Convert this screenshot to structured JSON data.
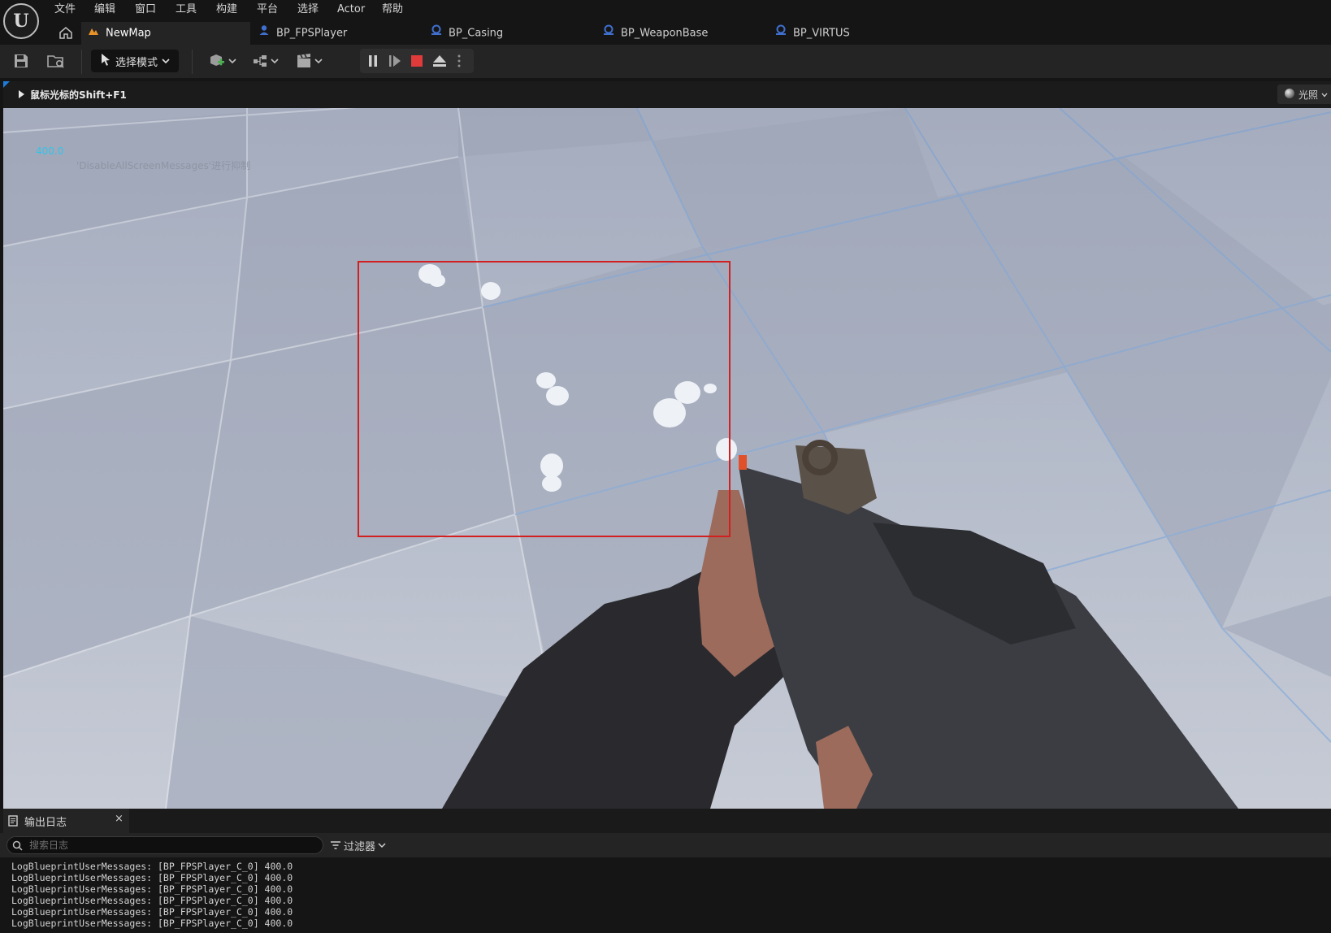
{
  "menu": {
    "items": [
      "文件",
      "编辑",
      "窗口",
      "工具",
      "构建",
      "平台",
      "选择",
      "Actor",
      "帮助"
    ]
  },
  "tabs": [
    {
      "label": "NewMap",
      "icon": "level-icon",
      "active": true
    },
    {
      "label": "BP_FPSPlayer",
      "icon": "blueprint-pawn-icon",
      "active": false
    },
    {
      "label": "BP_Casing",
      "icon": "blueprint-actor-icon",
      "active": false
    },
    {
      "label": "BP_WeaponBase",
      "icon": "blueprint-actor-icon",
      "active": false
    },
    {
      "label": "BP_VIRTUS",
      "icon": "blueprint-actor-icon",
      "active": false
    }
  ],
  "toolbar": {
    "mode_label": "选择模式",
    "icons": [
      "save-icon",
      "browse-content-icon",
      "add-actor-icon",
      "blueprint-menu-icon",
      "cinematics-icon",
      "pause-icon",
      "step-frame-icon",
      "stop-icon",
      "eject-icon",
      "more-options-icon"
    ]
  },
  "viewport": {
    "hint_text": "鼠标光标的Shift+F1",
    "lighting_label": "光照",
    "stat_value": "400.0",
    "stat_message": "'DisableAllScreenMessages'进行抑制"
  },
  "output_log": {
    "tab_label": "输出日志",
    "close_label": "×",
    "search_placeholder": "搜索日志",
    "filter_label": "过滤器",
    "lines": [
      "LogBlueprintUserMessages: [BP_FPSPlayer_C_0] 400.0",
      "LogBlueprintUserMessages: [BP_FPSPlayer_C_0] 400.0",
      "LogBlueprintUserMessages: [BP_FPSPlayer_C_0] 400.0",
      "LogBlueprintUserMessages: [BP_FPSPlayer_C_0] 400.0",
      "LogBlueprintUserMessages: [BP_FPSPlayer_C_0] 400.0",
      "LogBlueprintUserMessages: [BP_FPSPlayer_C_0] 400.0"
    ]
  },
  "colors": {
    "accent_blue": "#1e7ddb",
    "stat_cyan": "#33c3e8",
    "selection_red": "#d22020",
    "stop_red": "#e03b3b",
    "level_orange": "#e8922a"
  }
}
